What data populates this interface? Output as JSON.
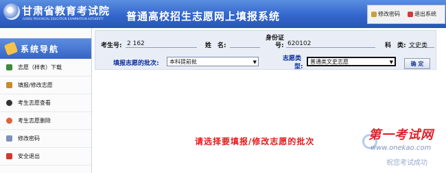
{
  "header": {
    "brand": "甘肃省教育考试院",
    "brand_en": "GANSU PROVINCIAL EDUCATION EXAMINATION AUTHORITY",
    "system_title": "普通高校招生志愿网上填报系统",
    "actions": [
      {
        "label": "修改密码",
        "icon": "key-icon",
        "color": "#c9a13a"
      },
      {
        "label": "退出系统",
        "icon": "exit-icon",
        "color": "#d23b3b"
      }
    ]
  },
  "sidebar": {
    "heading": "系统导航",
    "items": [
      {
        "label": "志愿（样表）下载",
        "icon": "download-icon",
        "color": "#3b8b3b"
      },
      {
        "label": "填报/修改志愿",
        "icon": "edit-icon",
        "color": "#c98a2d"
      },
      {
        "label": "考生志愿查看",
        "icon": "binoculars-icon",
        "color": "#333333"
      },
      {
        "label": "考生志愿删除",
        "icon": "delete-icon",
        "color": "#e0623a"
      },
      {
        "label": "修改密码",
        "icon": "key-icon",
        "color": "#7b93b8"
      },
      {
        "label": "安全退出",
        "icon": "exit-icon",
        "color": "#d0392e"
      }
    ]
  },
  "form": {
    "exam_no_label": "考生号:",
    "exam_no_value": "2 162",
    "name_label": "姓　名:",
    "name_value": "",
    "id_label_top": "身份证",
    "id_label_bottom": "号:",
    "id_value": "620102",
    "subject_label": "科　类:",
    "subject_value": "文史类",
    "batch_label": "填报志愿的批次:",
    "batch_value": "本科提前批",
    "type_label_top": "志愿类",
    "type_label_bottom": "型:",
    "type_value": "普通类文史志愿",
    "confirm_label": "确 定"
  },
  "main": {
    "prompt": "请选择要填报/修改志愿的批次"
  },
  "watermark": {
    "title": "第一考试网",
    "url": "www.onekao.com",
    "slogan": "祝您考试成功"
  },
  "colors": {
    "header_blue": "#3366cc",
    "prompt_red": "#e31b1b",
    "form_bg": "#e9eef6"
  }
}
